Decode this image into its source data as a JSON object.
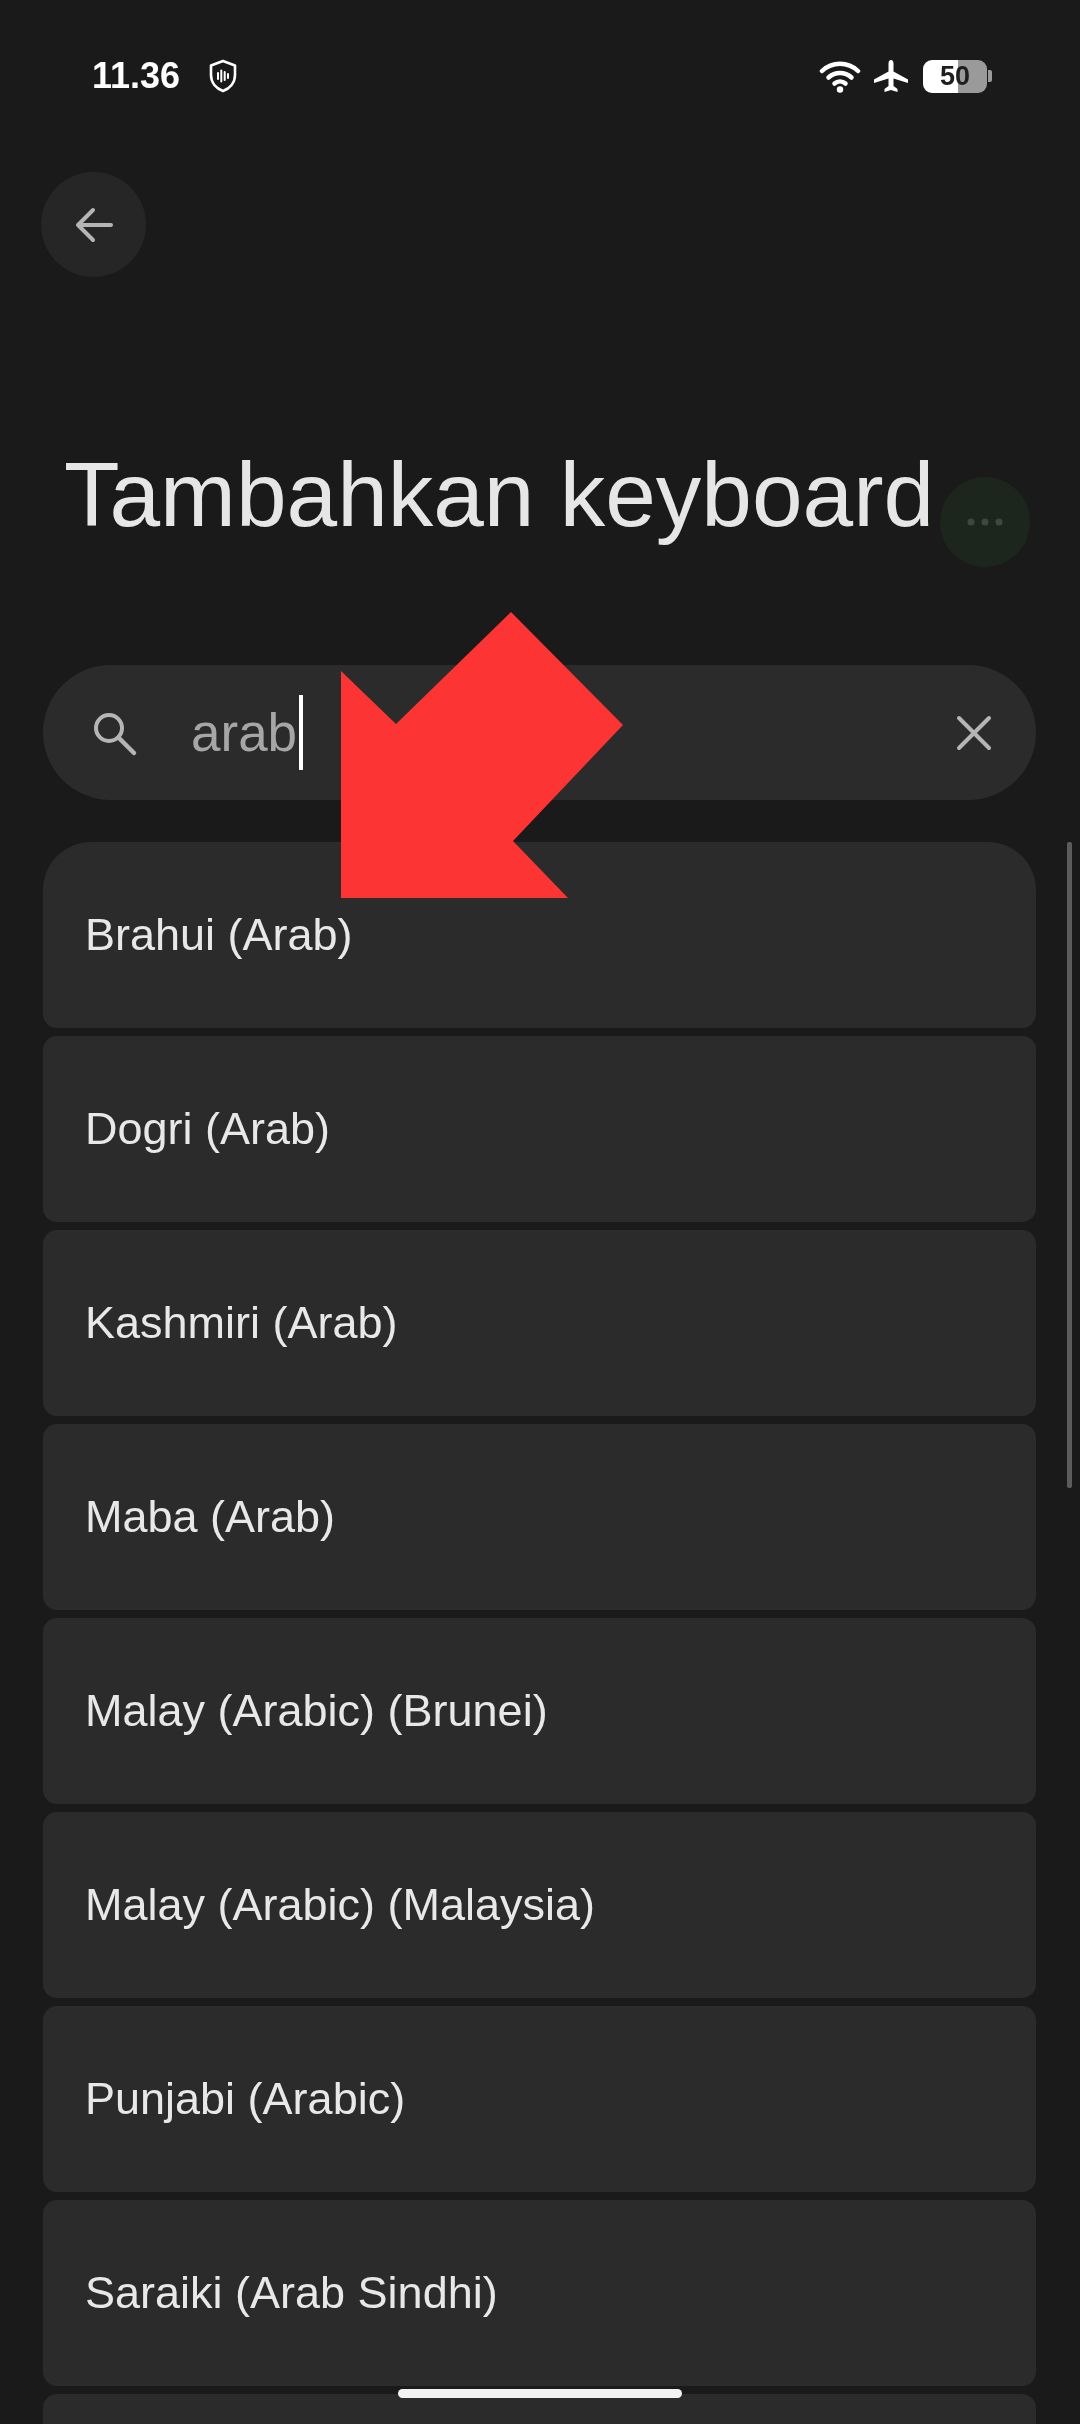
{
  "status_bar": {
    "time": "11.36",
    "battery": "50"
  },
  "header": {
    "title": "Tambahkan keyboard"
  },
  "search": {
    "value": "arab",
    "focused": true
  },
  "languages": [
    {
      "label": "Brahui (Arab)"
    },
    {
      "label": "Dogri (Arab)"
    },
    {
      "label": "Kashmiri (Arab)"
    },
    {
      "label": "Maba (Arab)"
    },
    {
      "label": "Malay (Arabic) (Brunei)"
    },
    {
      "label": "Malay (Arabic) (Malaysia)"
    },
    {
      "label": "Punjabi (Arabic)"
    },
    {
      "label": "Saraiki (Arab Sindhi)"
    }
  ]
}
